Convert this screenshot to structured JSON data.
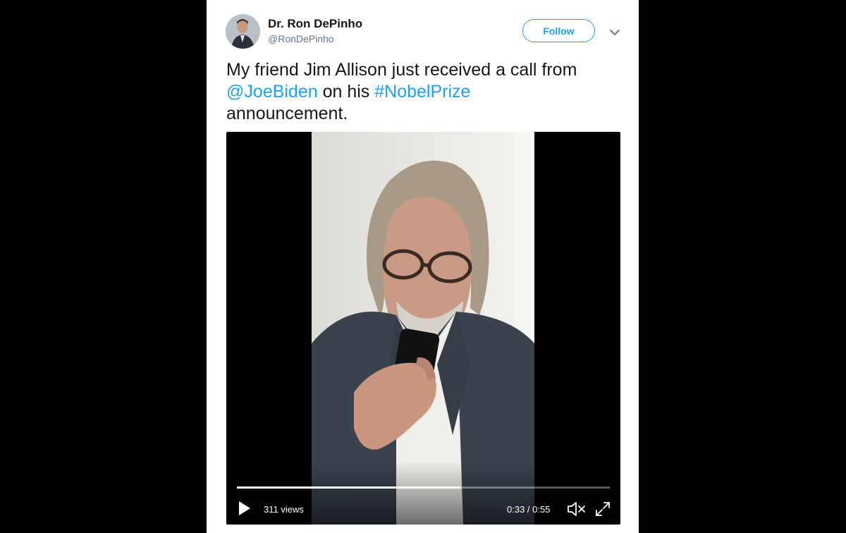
{
  "tweet": {
    "author_name": "Dr. Ron DePinho",
    "author_handle": "@RonDePinho",
    "follow_label": "Follow",
    "text_part1": "My friend Jim Allison just received a call from ",
    "mention": "@JoeBiden",
    "text_part2": " on his ",
    "hashtag": "#NobelPrize",
    "text_part3": " announcement."
  },
  "video": {
    "views": "311 views",
    "time": "0:33 / 0:55",
    "progress": 0.6
  },
  "colors": {
    "link": "#1da1f2",
    "text": "#14171a",
    "handle": "#657786",
    "page_background": "#000000"
  },
  "icons": {
    "avatar": "avatar-photo",
    "caret": "chevron-down-icon",
    "play": "play-icon",
    "mute": "volume-muted-icon",
    "fullscreen": "fullscreen-icon"
  }
}
